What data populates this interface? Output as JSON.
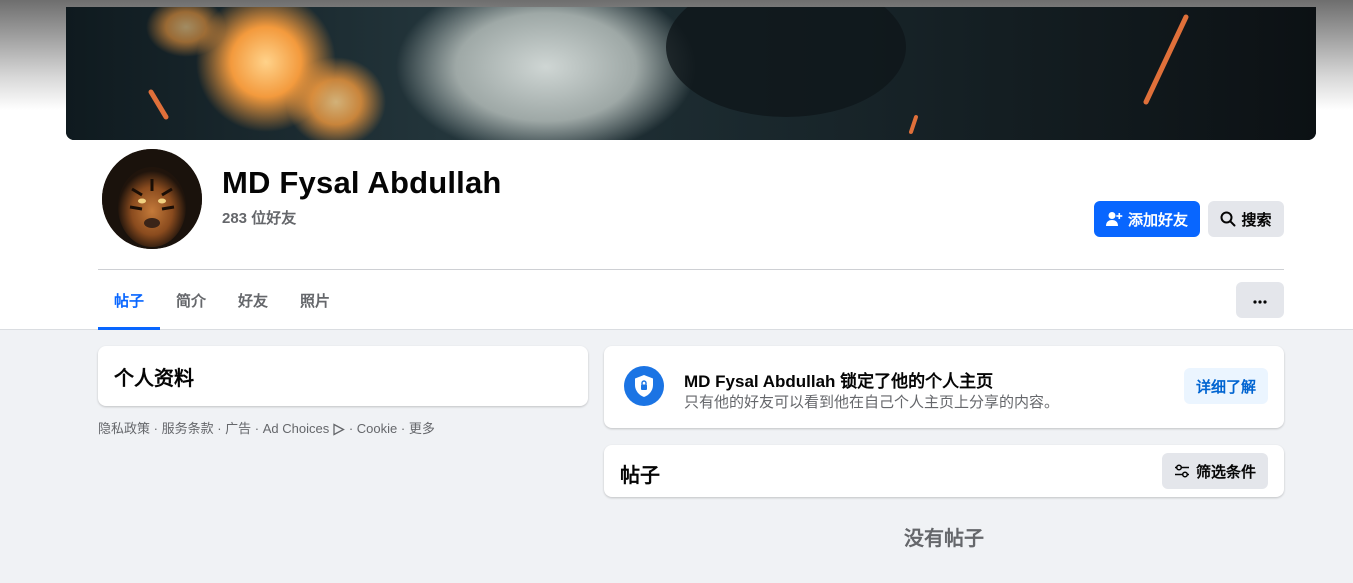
{
  "profile": {
    "name": "MD Fysal Abdullah",
    "friend_count": "283 位好友"
  },
  "actions": {
    "add_friend_label": "添加好友",
    "search_label": "搜索"
  },
  "tabs": [
    {
      "label": "帖子",
      "active": true
    },
    {
      "label": "简介",
      "active": false
    },
    {
      "label": "好友",
      "active": false
    },
    {
      "label": "照片",
      "active": false
    }
  ],
  "more_label": "···",
  "intro_card": {
    "title": "个人资料"
  },
  "footer_links": {
    "privacy": "隐私政策",
    "terms": "服务条款",
    "ads": "广告",
    "ad_choices": "Ad Choices",
    "cookie": "Cookie",
    "more": "更多",
    "separator": " · "
  },
  "lock_notice": {
    "title": "MD Fysal Abdullah 锁定了他的个人主页",
    "subtitle": "只有他的好友可以看到他在自己个人主页上分享的内容。",
    "learn_more_label": "详细了解"
  },
  "posts_section": {
    "title": "帖子",
    "filter_label": "筛选条件",
    "empty_text": "没有帖子"
  },
  "colors": {
    "accent": "#0866ff",
    "page_bg": "#f0f2f5",
    "secondary_text": "#65676b",
    "lock_icon_bg": "#1b74e4"
  },
  "icons": {
    "add_friend": "person-plus-icon",
    "search": "search-icon",
    "lock": "shield-lock-icon",
    "filter": "sliders-icon",
    "ad_choices": "ad-choices-icon"
  }
}
